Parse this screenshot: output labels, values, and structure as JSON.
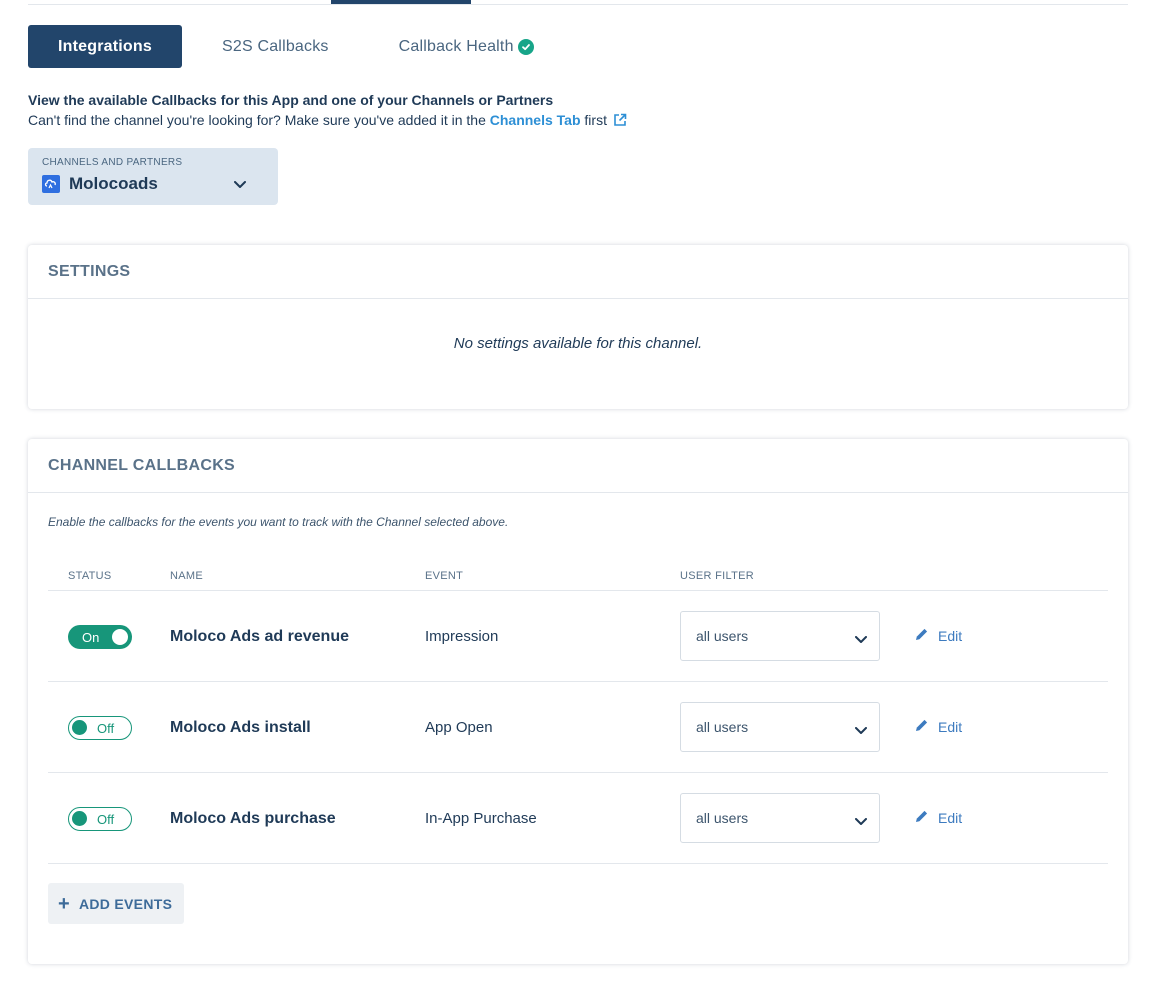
{
  "tabs": [
    {
      "label": "Integrations",
      "active": true
    },
    {
      "label": "S2S Callbacks",
      "active": false
    },
    {
      "label": "Callback Health",
      "active": false,
      "status_icon": "check-circle-icon"
    }
  ],
  "intro": {
    "heading": "View the available Callbacks for this App and one of your Channels or Partners",
    "subtext_before": "Can't find the channel you're looking for? Make sure you've added it in the ",
    "link_text": "Channels Tab",
    "subtext_after": " first"
  },
  "channel_select": {
    "caption": "CHANNELS AND PARTNERS",
    "selected": "Molocoads"
  },
  "settings": {
    "title": "SETTINGS",
    "empty_message": "No settings available for this channel."
  },
  "callbacks": {
    "title": "CHANNEL CALLBACKS",
    "description": "Enable the callbacks for the events you want to track with the Channel selected above.",
    "columns": {
      "status": "STATUS",
      "name": "NAME",
      "event": "EVENT",
      "user_filter": "USER FILTER"
    },
    "rows": [
      {
        "status": "On",
        "name": "Moloco Ads ad revenue",
        "event": "Impression",
        "filter": "all users",
        "edit": "Edit"
      },
      {
        "status": "Off",
        "name": "Moloco Ads install",
        "event": "App Open",
        "filter": "all users",
        "edit": "Edit"
      },
      {
        "status": "Off",
        "name": "Moloco Ads purchase",
        "event": "In-App Purchase",
        "filter": "all users",
        "edit": "Edit"
      }
    ],
    "add_button": "ADD EVENTS"
  },
  "colors": {
    "primary": "#22456b",
    "accent_green": "#17967a",
    "link": "#2d8fd5"
  }
}
